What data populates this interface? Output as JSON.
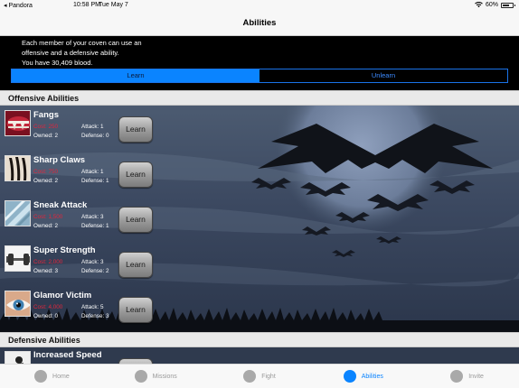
{
  "status": {
    "carrier": "Pandora",
    "time": "10:58 PM",
    "date": "Tue May 7",
    "battery": "60%"
  },
  "nav": {
    "title": "Abilities"
  },
  "intro": {
    "line1": "Each member of your coven can use an",
    "line2": "offensive and a defensive ability.",
    "line3": "You have 30,409 blood."
  },
  "segments": {
    "learn": "Learn",
    "unlearn": "Unlearn"
  },
  "sections": {
    "offensive": "Offensive Abilities",
    "defensive": "Defensive Abilities"
  },
  "learn_label": "Learn",
  "offensive": [
    {
      "name": "Fangs",
      "cost": "Cost: 250",
      "attack": "Attack: 1",
      "owned": "Owned: 2",
      "defense": "Defense: 0"
    },
    {
      "name": "Sharp Claws",
      "cost": "Cost: 750",
      "attack": "Attack: 1",
      "owned": "Owned: 2",
      "defense": "Defense: 1"
    },
    {
      "name": "Sneak Attack",
      "cost": "Cost: 1,500",
      "attack": "Attack: 3",
      "owned": "Owned: 2",
      "defense": "Defense: 1"
    },
    {
      "name": "Super Strength",
      "cost": "Cost: 2,000",
      "attack": "Attack: 3",
      "owned": "Owned: 3",
      "defense": "Defense: 2"
    },
    {
      "name": "Glamor Victim",
      "cost": "Cost: 4,000",
      "attack": "Attack: 5",
      "owned": "Owned: 0",
      "defense": "Defense: 3"
    }
  ],
  "defensive": [
    {
      "name": "Increased Speed"
    }
  ],
  "tabs": [
    {
      "label": "Home"
    },
    {
      "label": "Missions"
    },
    {
      "label": "Fight"
    },
    {
      "label": "Abilities"
    },
    {
      "label": "Invite"
    }
  ],
  "colors": {
    "accent": "#0a84ff",
    "cost": "#e0263d"
  }
}
